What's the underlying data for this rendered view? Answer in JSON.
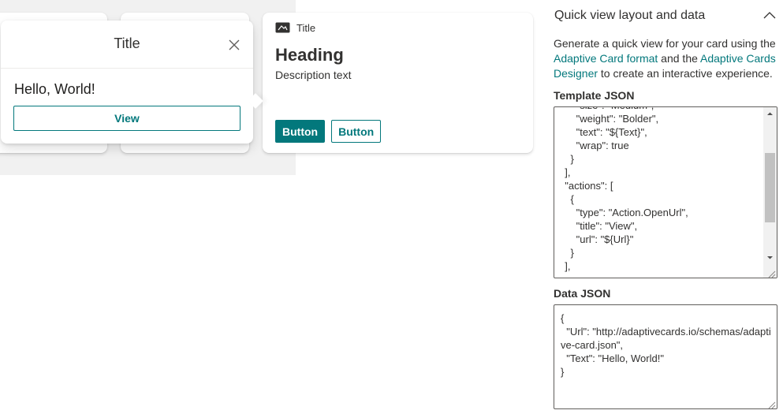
{
  "cards": {
    "main": {
      "header_title": "Title",
      "header_icon": "adaptive-card-icon",
      "heading": "Heading",
      "description": "Description text",
      "primary_button": "Button",
      "secondary_button": "Button"
    }
  },
  "quick_view": {
    "title": "Title",
    "body_text": "Hello, World!",
    "view_button": "View",
    "close_icon": "close-icon"
  },
  "pane": {
    "section_title": "Quick view layout and data",
    "collapse_icon": "chevron-up-icon",
    "description_prefix": "Generate a quick view for your card using the ",
    "link_format": "Adaptive Card format",
    "description_mid": " and the ",
    "link_designer": "Adaptive Cards Designer",
    "description_suffix": " to create an interactive experience.",
    "template_label": "Template JSON",
    "template_json": "      \"size\": \"Medium\",\n      \"weight\": \"Bolder\",\n      \"text\": \"${Text}\",\n      \"wrap\": true\n    }\n  ],\n  \"actions\": [\n    {\n      \"type\": \"Action.OpenUrl\",\n      \"title\": \"View\",\n      \"url\": \"${Url}\"\n    }\n  ],\n  ...",
    "data_label": "Data JSON",
    "data_json": "{\n  \"Url\": \"http://adaptivecards.io/schemas/adaptive-card.json\",\n  \"Text\": \"Hello, World!\"\n}"
  },
  "colors": {
    "accent": "#03787c",
    "text": "#323130",
    "canvas": "#f1f1f1"
  }
}
